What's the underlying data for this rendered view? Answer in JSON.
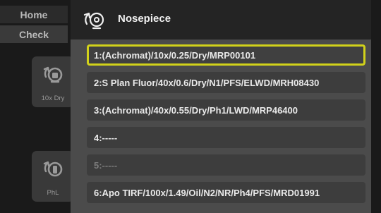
{
  "sidebar": {
    "tabs": [
      {
        "label": "Home"
      },
      {
        "label": "Check"
      }
    ],
    "tiles": [
      {
        "label": "10x Dry",
        "icon": "nosepiece-icon"
      },
      {
        "label": "PhL",
        "icon": "nosepiece-icon"
      }
    ]
  },
  "panel": {
    "title": "Nosepiece",
    "icon": "nosepiece-icon",
    "items": [
      {
        "label": "1:(Achromat)/10x/0.25/Dry/MRP00101",
        "selected": true
      },
      {
        "label": "2:S Plan Fluor/40x/0.6/Dry/N1/PFS/ELWD/MRH08430"
      },
      {
        "label": "3:(Achromat)/40x/0.55/Dry/Ph1/LWD/MRP46400"
      },
      {
        "label": "4:-----"
      },
      {
        "label": "5:-----",
        "disabled": true
      },
      {
        "label": "6:Apo TIRF/100x/1.49/Oil/N2/NR/Ph4/PFS/MRD01991"
      }
    ],
    "selected_color": "#d2d21a"
  }
}
